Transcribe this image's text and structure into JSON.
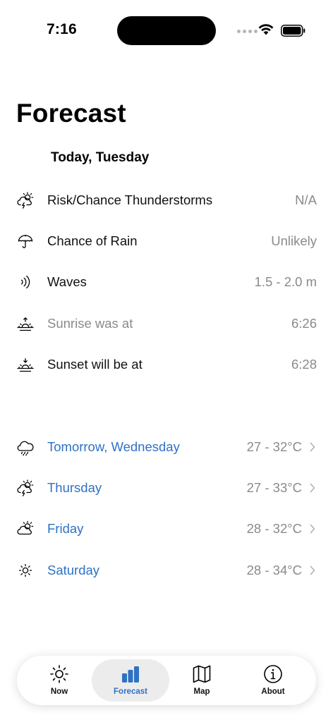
{
  "status_bar": {
    "time": "7:16"
  },
  "title": "Forecast",
  "today": {
    "heading": "Today, Tuesday",
    "rows": [
      {
        "icon": "thunderstorm-icon",
        "label": "Risk/Chance Thunderstorms",
        "value": "N/A"
      },
      {
        "icon": "umbrella-icon",
        "label": "Chance of Rain",
        "value": "Unlikely"
      },
      {
        "icon": "waves-icon",
        "label": "Waves",
        "value": "1.5 - 2.0 m"
      },
      {
        "icon": "sunrise-icon",
        "label": "Sunrise was at",
        "value": "6:26"
      },
      {
        "icon": "sunset-icon",
        "label": "Sunset will be at",
        "value": "6:28"
      }
    ]
  },
  "days": [
    {
      "icon": "rain-cloud-icon",
      "label": "Tomorrow, Wednesday",
      "value": "27 - 32°C"
    },
    {
      "icon": "thunderstorm-icon",
      "label": "Thursday",
      "value": "27 - 33°C"
    },
    {
      "icon": "partly-cloudy-icon",
      "label": "Friday",
      "value": "28 - 32°C"
    },
    {
      "icon": "sun-icon",
      "label": "Saturday",
      "value": "28 - 34°C"
    }
  ],
  "tabs": [
    {
      "icon": "sun-icon",
      "label": "Now",
      "active": false
    },
    {
      "icon": "bar-chart-icon",
      "label": "Forecast",
      "active": true
    },
    {
      "icon": "map-icon",
      "label": "Map",
      "active": false
    },
    {
      "icon": "info-icon",
      "label": "About",
      "active": false
    }
  ],
  "colors": {
    "accent": "#2f72c4",
    "muted": "#8a8a8a",
    "tab_active_bg": "#ececec"
  }
}
